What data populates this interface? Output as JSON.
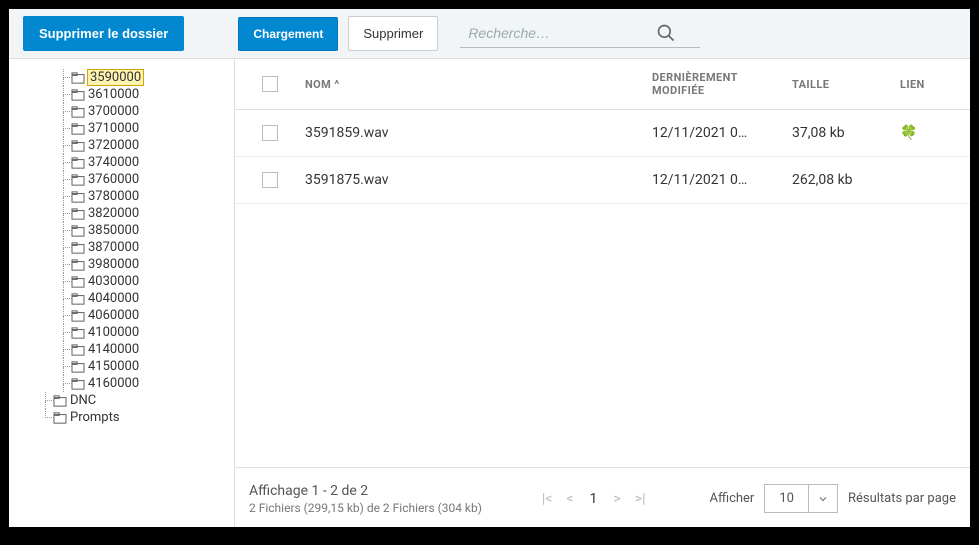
{
  "toolbar": {
    "delete_folder": "Supprimer le dossier",
    "upload": "Chargement",
    "delete": "Supprimer",
    "search_placeholder": "Recherche…"
  },
  "tree": {
    "items": [
      {
        "label": "3590000",
        "selected": true
      },
      {
        "label": "3610000"
      },
      {
        "label": "3700000"
      },
      {
        "label": "3710000"
      },
      {
        "label": "3720000"
      },
      {
        "label": "3740000"
      },
      {
        "label": "3760000"
      },
      {
        "label": "3780000"
      },
      {
        "label": "3820000"
      },
      {
        "label": "3850000"
      },
      {
        "label": "3870000"
      },
      {
        "label": "3980000"
      },
      {
        "label": "4030000"
      },
      {
        "label": "4040000"
      },
      {
        "label": "4060000"
      },
      {
        "label": "4100000"
      },
      {
        "label": "4140000"
      },
      {
        "label": "4150000"
      },
      {
        "label": "4160000"
      }
    ],
    "level2": [
      {
        "label": "DNC"
      },
      {
        "label": "Prompts"
      }
    ]
  },
  "table": {
    "headers": {
      "name": "NOM",
      "date": "DERNIÈREMENT MODIFIÉE",
      "size": "TAILLE",
      "link": "LIEN"
    },
    "sort_indicator": " ^",
    "rows": [
      {
        "name": "3591859.wav",
        "date": "12/11/2021 0…",
        "size": "37,08 kb",
        "has_link": true
      },
      {
        "name": "3591875.wav",
        "date": "12/11/2021 0…",
        "size": "262,08 kb",
        "has_link": false
      }
    ]
  },
  "footer": {
    "display_text": "Affichage 1 - 2 de 2",
    "summary": "2 Fichiers (299,15 kb) de 2 Fichiers (304 kb)",
    "show_label": "Afficher",
    "per_page_value": "10",
    "per_page_label": "Résultats par page",
    "page": "1"
  }
}
